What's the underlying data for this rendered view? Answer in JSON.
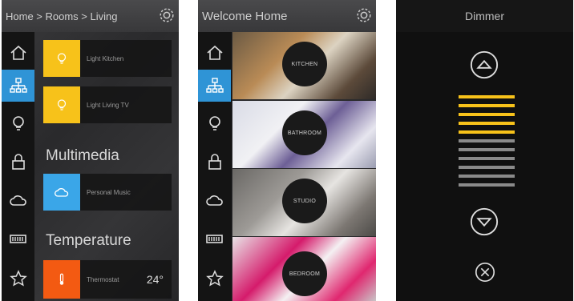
{
  "screen1": {
    "breadcrumb": "Home > Rooms > Living",
    "tiles": [
      {
        "label": "Light Kitchen",
        "color": "#f7c21a"
      },
      {
        "label": "Light Living TV",
        "color": "#f7c21a"
      },
      {
        "label": "Personal Music",
        "color": "#3aa6e8"
      },
      {
        "label": "Thermostat",
        "color": "#f35a12",
        "value": "24°"
      }
    ],
    "sections": [
      "Multimedia",
      "Temperature"
    ]
  },
  "screen2": {
    "title": "Welcome Home",
    "rooms": [
      "KITCHEN",
      "BATHROOM",
      "STUDIO",
      "BEDROOM"
    ]
  },
  "screen3": {
    "title": "Dimmer",
    "level_bars_on": 5,
    "level_bars_total": 11
  },
  "colors": {
    "accent_blue": "#2f94d6",
    "yellow": "#f7c21a",
    "orange": "#f35a12"
  },
  "icons": [
    "home-icon",
    "network-icon",
    "bulb-icon",
    "lock-icon",
    "cloud-icon",
    "battery-icon",
    "star-icon",
    "gear-icon"
  ]
}
